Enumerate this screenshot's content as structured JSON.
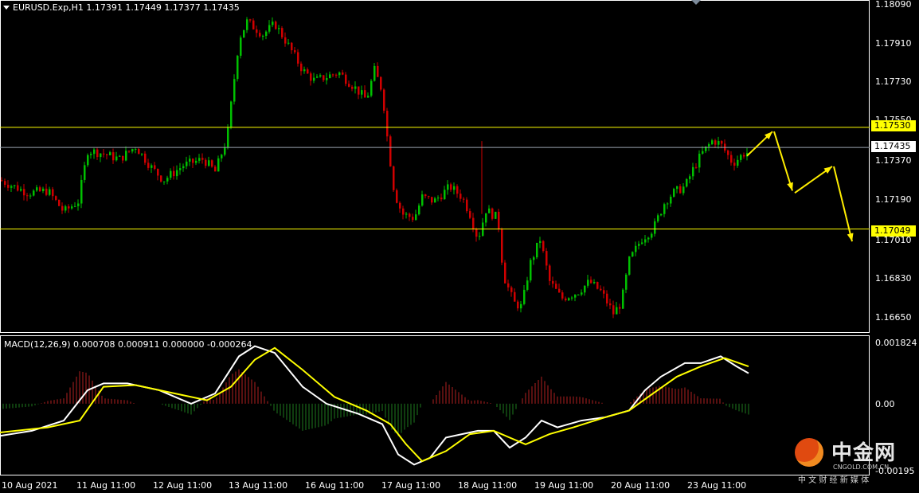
{
  "window": {
    "symbol_header": "EURUSD.Exp,H1  1.17391 1.17449 1.17377 1.17435",
    "macd_header": "MACD(12,26,9) 0.000708 0.000911 0.000000 -0.000264"
  },
  "price_axis": {
    "labels": [
      "1.18090",
      "1.17910",
      "1.17730",
      "1.17550",
      "1.17370",
      "1.17190",
      "1.17010",
      "1.16830",
      "1.16650"
    ]
  },
  "macd_axis": {
    "labels": [
      "0.001824",
      "0.00",
      "-0.00195"
    ]
  },
  "time_axis": {
    "labels": [
      "10 Aug 2021",
      "11 Aug 11:00",
      "12 Aug 11:00",
      "13 Aug 11:00",
      "16 Aug 11:00",
      "17 Aug 11:00",
      "18 Aug 11:00",
      "19 Aug 11:00",
      "20 Aug 11:00",
      "23 Aug 11:00"
    ]
  },
  "levels": {
    "resistance": "1.17530",
    "current": "1.17435",
    "support": "1.17049"
  },
  "colors": {
    "background": "#000000",
    "bull": "#00c000",
    "bear": "#d00000",
    "level_line": "#ffff00",
    "macd_line": "#ffffff",
    "signal_line": "#ffff00",
    "hist_pos": "#b02020",
    "hist_neg": "#1e7a1e",
    "arrow": "#ffee00"
  },
  "watermark": {
    "brand": "中金网",
    "domain": "CNGOLD.COM.CN",
    "tagline": "中 文 财 经 新 媒 体"
  },
  "chart_data": {
    "type": "candlestick",
    "path_points": [
      [
        0,
        1.1728
      ],
      [
        35,
        1.1722
      ],
      [
        60,
        1.1723
      ],
      [
        80,
        1.1713
      ],
      [
        98,
        1.1718
      ],
      [
        110,
        1.1742
      ],
      [
        125,
        1.1741
      ],
      [
        150,
        1.1738
      ],
      [
        170,
        1.1744
      ],
      [
        190,
        1.1734
      ],
      [
        205,
        1.1728
      ],
      [
        230,
        1.1735
      ],
      [
        255,
        1.1738
      ],
      [
        270,
        1.1732
      ],
      [
        285,
        1.1748
      ],
      [
        292,
        1.177
      ],
      [
        300,
        1.1795
      ],
      [
        310,
        1.1803
      ],
      [
        330,
        1.1797
      ],
      [
        345,
        1.1802
      ],
      [
        360,
        1.1793
      ],
      [
        380,
        1.178
      ],
      [
        395,
        1.1775
      ],
      [
        410,
        1.1777
      ],
      [
        425,
        1.1779
      ],
      [
        445,
        1.1772
      ],
      [
        460,
        1.1766
      ],
      [
        470,
        1.178
      ],
      [
        480,
        1.177
      ],
      [
        487,
        1.1745
      ],
      [
        495,
        1.1722
      ],
      [
        505,
        1.1712
      ],
      [
        520,
        1.171
      ],
      [
        530,
        1.172
      ],
      [
        545,
        1.1718
      ],
      [
        565,
        1.1725
      ],
      [
        580,
        1.172
      ],
      [
        590,
        1.1712
      ],
      [
        600,
        1.17
      ],
      [
        610,
        1.1714
      ],
      [
        625,
        1.171
      ],
      [
        632,
        1.1683
      ],
      [
        645,
        1.167
      ],
      [
        655,
        1.1668
      ],
      [
        665,
        1.1688
      ],
      [
        678,
        1.17
      ],
      [
        690,
        1.168
      ],
      [
        705,
        1.1672
      ],
      [
        725,
        1.1675
      ],
      [
        740,
        1.168
      ],
      [
        755,
        1.1675
      ],
      [
        770,
        1.1665
      ],
      [
        780,
        1.167
      ],
      [
        790,
        1.169
      ],
      [
        805,
        1.17
      ],
      [
        820,
        1.1705
      ],
      [
        835,
        1.1718
      ],
      [
        845,
        1.1722
      ],
      [
        860,
        1.1725
      ],
      [
        870,
        1.1733
      ],
      [
        880,
        1.174
      ],
      [
        895,
        1.1747
      ],
      [
        905,
        1.1745
      ],
      [
        920,
        1.1736
      ],
      [
        935,
        1.1741
      ]
    ],
    "macd": [
      [
        0,
        -0.00095
      ],
      [
        40,
        -0.0008
      ],
      [
        80,
        -0.0005
      ],
      [
        110,
        0.0004
      ],
      [
        130,
        0.0006
      ],
      [
        160,
        0.0006
      ],
      [
        200,
        0.0004
      ],
      [
        240,
        0.0
      ],
      [
        270,
        0.0003
      ],
      [
        300,
        0.0014
      ],
      [
        320,
        0.0017
      ],
      [
        345,
        0.0015
      ],
      [
        380,
        0.0005
      ],
      [
        410,
        0.0
      ],
      [
        450,
        -0.0003
      ],
      [
        480,
        -0.0006
      ],
      [
        500,
        -0.0015
      ],
      [
        520,
        -0.0018
      ],
      [
        540,
        -0.0016
      ],
      [
        560,
        -0.001
      ],
      [
        580,
        -0.0009
      ],
      [
        600,
        -0.0008
      ],
      [
        620,
        -0.0008
      ],
      [
        640,
        -0.0013
      ],
      [
        660,
        -0.001
      ],
      [
        680,
        -0.0005
      ],
      [
        700,
        -0.0007
      ],
      [
        730,
        -0.0005
      ],
      [
        760,
        -0.0004
      ],
      [
        790,
        -0.0002
      ],
      [
        810,
        0.0004
      ],
      [
        830,
        0.0008
      ],
      [
        860,
        0.0012
      ],
      [
        880,
        0.0012
      ],
      [
        905,
        0.0014
      ],
      [
        925,
        0.0011
      ],
      [
        940,
        0.0009
      ]
    ],
    "signal": [
      [
        0,
        -0.00085
      ],
      [
        60,
        -0.0007
      ],
      [
        100,
        -0.0005
      ],
      [
        130,
        0.0005
      ],
      [
        170,
        0.00055
      ],
      [
        220,
        0.0003
      ],
      [
        260,
        0.0001
      ],
      [
        290,
        0.0005
      ],
      [
        320,
        0.0013
      ],
      [
        345,
        0.00165
      ],
      [
        380,
        0.001
      ],
      [
        420,
        0.0002
      ],
      [
        460,
        -0.0002
      ],
      [
        490,
        -0.0006
      ],
      [
        510,
        -0.0012
      ],
      [
        530,
        -0.0017
      ],
      [
        560,
        -0.0014
      ],
      [
        590,
        -0.0009
      ],
      [
        620,
        -0.0008
      ],
      [
        660,
        -0.0012
      ],
      [
        690,
        -0.0009
      ],
      [
        720,
        -0.0007
      ],
      [
        760,
        -0.0004
      ],
      [
        790,
        -0.0002
      ],
      [
        820,
        0.0003
      ],
      [
        850,
        0.0008
      ],
      [
        880,
        0.0011
      ],
      [
        910,
        0.00135
      ],
      [
        940,
        0.0011
      ]
    ],
    "levels": [
      1.1753,
      1.17435,
      1.17049
    ],
    "forecast_arrows": [
      [
        [
          938,
          1.17395
        ],
        [
          970,
          1.1751
        ]
      ],
      [
        [
          972,
          1.1751
        ],
        [
          995,
          1.1723
        ]
      ],
      [
        [
          998,
          1.1722
        ],
        [
          1045,
          1.17345
        ]
      ],
      [
        [
          1047,
          1.17345
        ],
        [
          1070,
          1.1699
        ]
      ]
    ],
    "ylim_price": [
      1.1661,
      1.1811
    ],
    "ylim_macd": [
      -0.00205,
      0.00195
    ]
  }
}
